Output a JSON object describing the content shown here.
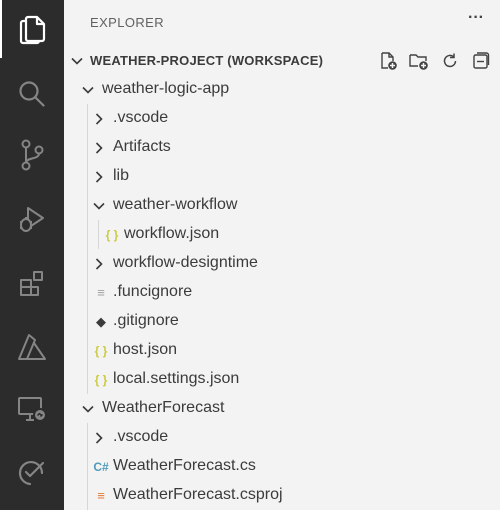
{
  "activity_bar": {
    "items": [
      {
        "icon": "files-icon",
        "active": true
      },
      {
        "icon": "search-icon",
        "active": false
      },
      {
        "icon": "source-control-icon",
        "active": false
      },
      {
        "icon": "run-debug-icon",
        "active": false
      },
      {
        "icon": "extensions-icon",
        "active": false
      },
      {
        "icon": "azure-icon",
        "active": false
      },
      {
        "icon": "remote-explorer-icon",
        "active": false
      },
      {
        "icon": "testing-icon",
        "active": false
      }
    ],
    "background": "#2c2c2c"
  },
  "sidebar": {
    "title": "EXPLORER",
    "more_label": "···",
    "workspace": {
      "label": "WEATHER-PROJECT (WORKSPACE)",
      "actions": [
        "new-file-icon",
        "new-folder-icon",
        "refresh-icon",
        "collapse-all-icon"
      ]
    },
    "tree": [
      {
        "label": "weather-logic-app",
        "type": "folder",
        "expanded": true,
        "depth": 0
      },
      {
        "label": ".vscode",
        "type": "folder",
        "expanded": false,
        "depth": 1
      },
      {
        "label": "Artifacts",
        "type": "folder",
        "expanded": false,
        "depth": 1
      },
      {
        "label": "lib",
        "type": "folder",
        "expanded": false,
        "depth": 1
      },
      {
        "label": "weather-workflow",
        "type": "folder",
        "expanded": true,
        "depth": 1
      },
      {
        "label": "workflow.json",
        "type": "json",
        "depth": 2
      },
      {
        "label": "workflow-designtime",
        "type": "folder",
        "expanded": false,
        "depth": 1
      },
      {
        "label": ".funcignore",
        "type": "text",
        "depth": 1
      },
      {
        "label": ".gitignore",
        "type": "git",
        "depth": 1
      },
      {
        "label": "host.json",
        "type": "json",
        "depth": 1
      },
      {
        "label": "local.settings.json",
        "type": "json",
        "depth": 1
      },
      {
        "label": "WeatherForecast",
        "type": "folder",
        "expanded": true,
        "depth": 0
      },
      {
        "label": ".vscode",
        "type": "folder",
        "expanded": false,
        "depth": 1
      },
      {
        "label": "WeatherForecast.cs",
        "type": "csharp",
        "depth": 1
      },
      {
        "label": "WeatherForecast.csproj",
        "type": "rss",
        "depth": 1
      }
    ]
  },
  "colors": {
    "json": "#cbcb41",
    "csharp": "#519aba",
    "rss": "#e37933",
    "git": "#3b3b3b",
    "text": "#a0a0a0",
    "sidebar_bg": "#f3f3f3",
    "guide": "#d6d6d6"
  }
}
